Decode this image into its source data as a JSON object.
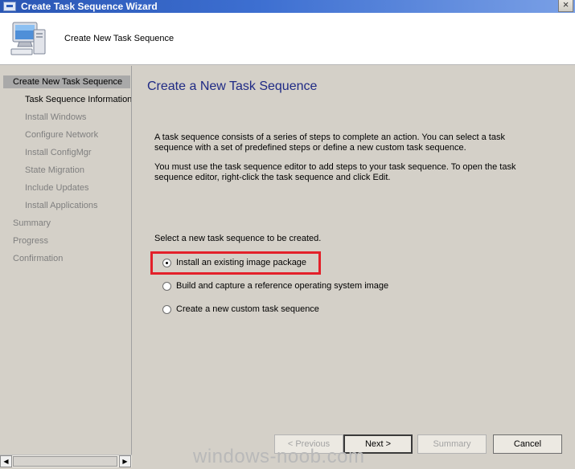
{
  "window": {
    "title": "Create Task Sequence Wizard",
    "close_glyph": "×"
  },
  "header": {
    "text": "Create New Task Sequence",
    "icon": "computer-icon"
  },
  "nav": {
    "items": [
      {
        "label": "Create New Task Sequence",
        "state": "selected"
      },
      {
        "label": "Task Sequence Information",
        "state": "current"
      },
      {
        "label": "Install Windows",
        "state": "inactive"
      },
      {
        "label": "Configure Network",
        "state": "inactive"
      },
      {
        "label": "Install ConfigMgr",
        "state": "inactive"
      },
      {
        "label": "State Migration",
        "state": "inactive"
      },
      {
        "label": "Include Updates",
        "state": "inactive"
      },
      {
        "label": "Install Applications",
        "state": "inactive"
      },
      {
        "label": "Summary",
        "state": "inactive"
      },
      {
        "label": "Progress",
        "state": "inactive"
      },
      {
        "label": "Confirmation",
        "state": "inactive"
      }
    ],
    "scroll_left_glyph": "◀",
    "scroll_right_glyph": "▶"
  },
  "main": {
    "title": "Create a New Task Sequence",
    "paragraph1": "A task sequence consists of a series of steps to complete an action. You can select a task sequence with a set of predefined steps or define a new custom task sequence.",
    "paragraph2": "You must use the task sequence editor to add steps to your task sequence. To open the task sequence editor, right-click the task sequence and click Edit.",
    "select_label": "Select a new task sequence to be created.",
    "options": [
      {
        "label": "Install an existing image package",
        "checked": true
      },
      {
        "label": "Build and capture a reference operating system image",
        "checked": false
      },
      {
        "label": "Create a new custom task sequence",
        "checked": false
      }
    ]
  },
  "buttons": {
    "previous": "< Previous",
    "next": "Next >",
    "summary": "Summary",
    "cancel": "Cancel"
  },
  "watermark": "windows-noob.com",
  "colors": {
    "highlight": "#e3202a",
    "title": "#1f2a85",
    "titlebar": "#2a56b4"
  }
}
